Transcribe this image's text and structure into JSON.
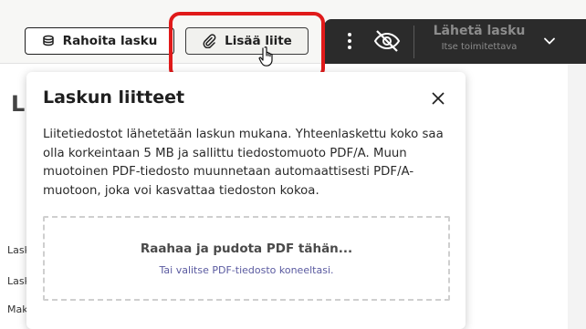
{
  "toolbar": {
    "fund_label": "Rahoita lasku",
    "attach_label": "Lisää liite",
    "send_title": "Lähetä lasku",
    "send_subtitle": "Itse toimitettava"
  },
  "background": {
    "heading": "Lu",
    "labels": [
      "Lask",
      "Lask",
      "Mak"
    ]
  },
  "attachment_panel": {
    "title": "Laskun liitteet",
    "description": "Liitetiedostot lähetetään laskun mukana. Yhteenlaskettu koko saa olla korkeintaan 5 MB ja sallittu tiedostomuoto PDF/A. Muun muotoinen PDF-tiedosto muunnetaan automaattisesti PDF/A-muotoon, joka voi kasvattaa tiedoston kokoa.",
    "dropzone_title": "Raahaa ja pudota PDF tähän...",
    "dropzone_link": "Tai valitse PDF-tiedosto koneeltasi."
  },
  "colors": {
    "highlight": "#e01a1a",
    "dark_bar": "#2b2b2b",
    "link": "#5a5aa0"
  },
  "icons": [
    "coins-icon",
    "paperclip-icon",
    "hand-cursor-icon",
    "more-vertical-icon",
    "eye-off-icon",
    "chevron-down-icon",
    "close-icon"
  ]
}
